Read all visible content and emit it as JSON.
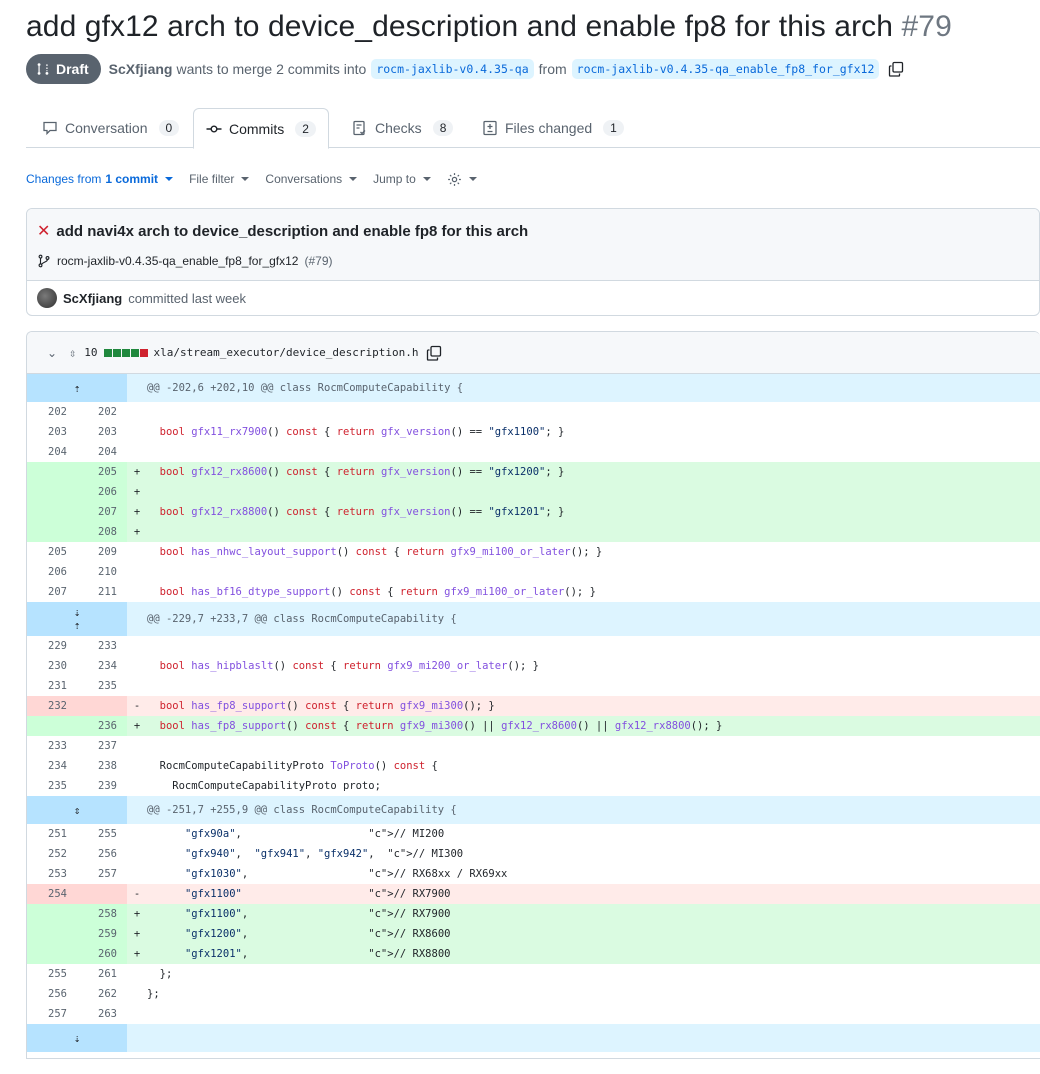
{
  "pr": {
    "title": "add gfx12 arch to device_description and enable fp8 for this arch",
    "number": "#79",
    "state": "Draft",
    "author": "ScXfjiang",
    "merge_text_1": "wants to merge 2 commits into",
    "base_branch": "rocm-jaxlib-v0.4.35-qa",
    "merge_text_2": "from",
    "head_branch": "rocm-jaxlib-v0.4.35-qa_enable_fp8_for_gfx12"
  },
  "tabs": [
    {
      "label": "Conversation",
      "count": "0",
      "icon": "comment-icon"
    },
    {
      "label": "Commits",
      "count": "2",
      "icon": "commit-icon"
    },
    {
      "label": "Checks",
      "count": "8",
      "icon": "checklist-icon"
    },
    {
      "label": "Files changed",
      "count": "1",
      "icon": "diff-icon"
    }
  ],
  "toolbar": {
    "changes_prefix": "Changes from",
    "changes_bold": "1 commit",
    "file_filter": "File filter",
    "conversations": "Conversations",
    "jump_to": "Jump to"
  },
  "commit": {
    "title": "add navi4x arch to device_description and enable fp8 for this arch",
    "branch": "rocm-jaxlib-v0.4.35-qa_enable_fp8_for_gfx12",
    "pr_ref": "(#79)",
    "author": "ScXfjiang",
    "when": "committed last week"
  },
  "file": {
    "changes": "10",
    "path": "xla/stream_executor/device_description.h"
  },
  "hunks": [
    "@@ -202,6 +202,10 @@ class RocmComputeCapability {",
    "@@ -229,7 +233,7 @@ class RocmComputeCapability {",
    "@@ -251,7 +255,9 @@ class RocmComputeCapability {"
  ],
  "lines": [
    {
      "o": "202",
      "n": "202",
      "s": "",
      "t": ""
    },
    {
      "o": "203",
      "n": "203",
      "s": "",
      "t": "  bool gfx11_rx7900() const { return gfx_version() == \"gfx1100\"; }"
    },
    {
      "o": "204",
      "n": "204",
      "s": "",
      "t": ""
    },
    {
      "o": "",
      "n": "205",
      "s": "+",
      "t": "  bool gfx12_rx8600() const { return gfx_version() == \"gfx1200\"; }"
    },
    {
      "o": "",
      "n": "206",
      "s": "+",
      "t": ""
    },
    {
      "o": "",
      "n": "207",
      "s": "+",
      "t": "  bool gfx12_rx8800() const { return gfx_version() == \"gfx1201\"; }"
    },
    {
      "o": "",
      "n": "208",
      "s": "+",
      "t": ""
    },
    {
      "o": "205",
      "n": "209",
      "s": "",
      "t": "  bool has_nhwc_layout_support() const { return gfx9_mi100_or_later(); }"
    },
    {
      "o": "206",
      "n": "210",
      "s": "",
      "t": ""
    },
    {
      "o": "207",
      "n": "211",
      "s": "",
      "t": "  bool has_bf16_dtype_support() const { return gfx9_mi100_or_later(); }"
    },
    {
      "o": "229",
      "n": "233",
      "s": "",
      "t": ""
    },
    {
      "o": "230",
      "n": "234",
      "s": "",
      "t": "  bool has_hipblaslt() const { return gfx9_mi200_or_later(); }"
    },
    {
      "o": "231",
      "n": "235",
      "s": "",
      "t": ""
    },
    {
      "o": "232",
      "n": "",
      "s": "-",
      "t": "  bool has_fp8_support() const { return gfx9_mi300(); }"
    },
    {
      "o": "",
      "n": "236",
      "s": "+",
      "t": "  bool has_fp8_support() const { return gfx9_mi300() || gfx12_rx8600() || gfx12_rx8800(); }"
    },
    {
      "o": "233",
      "n": "237",
      "s": "",
      "t": ""
    },
    {
      "o": "234",
      "n": "238",
      "s": "",
      "t": "  RocmComputeCapabilityProto ToProto() const {"
    },
    {
      "o": "235",
      "n": "239",
      "s": "",
      "t": "    RocmComputeCapabilityProto proto;"
    },
    {
      "o": "251",
      "n": "255",
      "s": "",
      "t": "      \"gfx90a\",                    // MI200"
    },
    {
      "o": "252",
      "n": "256",
      "s": "",
      "t": "      \"gfx940\",  \"gfx941\", \"gfx942\",  // MI300"
    },
    {
      "o": "253",
      "n": "257",
      "s": "",
      "t": "      \"gfx1030\",                   // RX68xx / RX69xx"
    },
    {
      "o": "254",
      "n": "",
      "s": "-",
      "t": "      \"gfx1100\"                    // RX7900"
    },
    {
      "o": "",
      "n": "258",
      "s": "+",
      "t": "      \"gfx1100\",                   // RX7900"
    },
    {
      "o": "",
      "n": "259",
      "s": "+",
      "t": "      \"gfx1200\",                   // RX8600"
    },
    {
      "o": "",
      "n": "260",
      "s": "+",
      "t": "      \"gfx1201\",                   // RX8800"
    },
    {
      "o": "255",
      "n": "261",
      "s": "",
      "t": "  };"
    },
    {
      "o": "256",
      "n": "262",
      "s": "",
      "t": "};"
    },
    {
      "o": "257",
      "n": "263",
      "s": "",
      "t": ""
    }
  ],
  "colors": {
    "added_bg": "#dafbe1",
    "deleted_bg": "#ffebe9",
    "hunk_bg": "#ddf4ff",
    "draft_badge": "#59636e",
    "link": "#0969da"
  }
}
